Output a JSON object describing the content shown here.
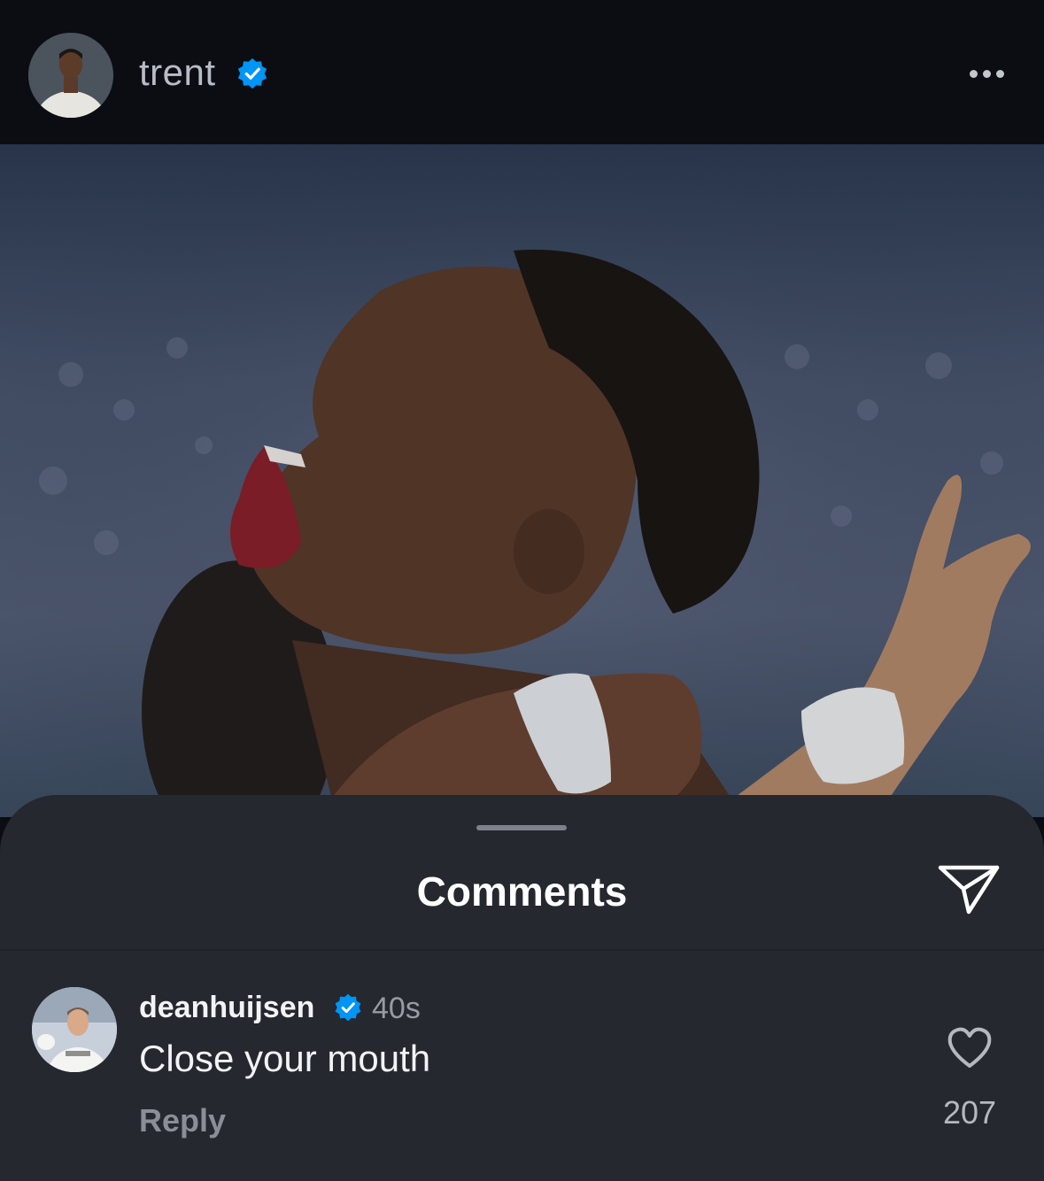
{
  "post": {
    "username": "trent",
    "verified": true,
    "image_alt": "Player celebrating"
  },
  "comments_sheet": {
    "title": "Comments"
  },
  "comment": {
    "username": "deanhuijsen",
    "verified": true,
    "time": "40s",
    "text": "Close your mouth",
    "reply_label": "Reply",
    "like_count": "207"
  },
  "colors": {
    "verified_blue": "#0095f6",
    "background": "#0b0d12",
    "sheet": "#25282e"
  },
  "icons": {
    "more": "more-horizontal-icon",
    "share": "paper-plane-icon",
    "like": "heart-outline-icon",
    "verified": "verified-badge-icon"
  }
}
